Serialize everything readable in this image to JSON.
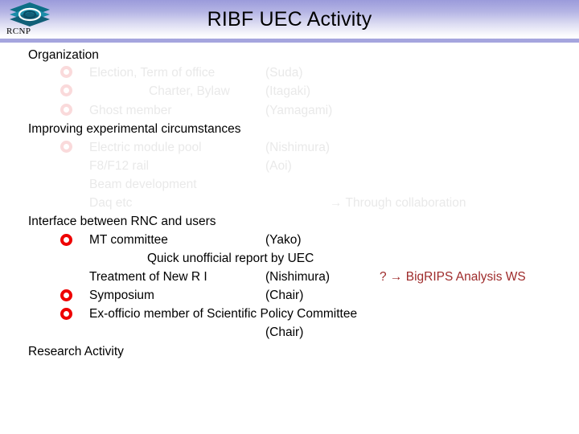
{
  "header": {
    "title": "RIBF UEC Activity",
    "logo_text": "RCNP",
    "logo_icon": "rcnp-stacked-layers-logo",
    "accent_color": "#a5a5de"
  },
  "colors": {
    "dark_text": "#000000",
    "faded_text": "#e9e9e9",
    "red_text": "#9e2b2b",
    "bullet_active": "#ee0000",
    "bullet_faded": "#fadadb"
  },
  "content": {
    "sections": [
      {
        "heading": "Organization",
        "items": [
          {
            "bullet": "faded",
            "label": "Election, Term of office",
            "owner": "(Suda)",
            "style": "faded"
          },
          {
            "bullet": "faded",
            "label": "Charter, Bylaw",
            "owner": "(Itagaki)",
            "style": "faded"
          },
          {
            "bullet": "faded",
            "label": "Ghost member",
            "owner": "(Yamagami)",
            "style": "faded"
          }
        ]
      },
      {
        "heading": "Improving experimental circumstances",
        "items": [
          {
            "bullet": "faded",
            "label": "Electric module pool",
            "owner": "(Nishimura)",
            "style": "faded"
          },
          {
            "bullet": "none",
            "label": "F8/F12 rail",
            "owner": "(Aoi)",
            "style": "faded"
          },
          {
            "bullet": "none",
            "label": "Beam development",
            "owner": "",
            "style": "faded"
          },
          {
            "bullet": "none",
            "label": "Daq etc",
            "owner": "",
            "style": "faded",
            "note": "→ Through collaboration"
          }
        ]
      },
      {
        "heading": "Interface between RNC and users",
        "items": [
          {
            "bullet": "active",
            "label": "MT committee",
            "owner": "(Yako)",
            "style": "dark"
          },
          {
            "bullet": "none",
            "label": "Quick unofficial report by UEC",
            "owner": "",
            "style": "dark"
          },
          {
            "bullet": "none",
            "label": "Treatment of New R I",
            "owner": "(Nishimura)",
            "style": "dark",
            "note": "? → BigRIPS Analysis WS"
          },
          {
            "bullet": "active",
            "label": "Symposium",
            "owner": "(Chair)",
            "style": "dark"
          },
          {
            "bullet": "active",
            "label": "Ex-officio member of Scientific Policy Committee",
            "owner": "",
            "style": "dark"
          },
          {
            "bullet": "none",
            "label": "",
            "owner": "(Chair)",
            "style": "dark"
          }
        ]
      },
      {
        "heading": "Research Activity",
        "items": []
      }
    ]
  }
}
